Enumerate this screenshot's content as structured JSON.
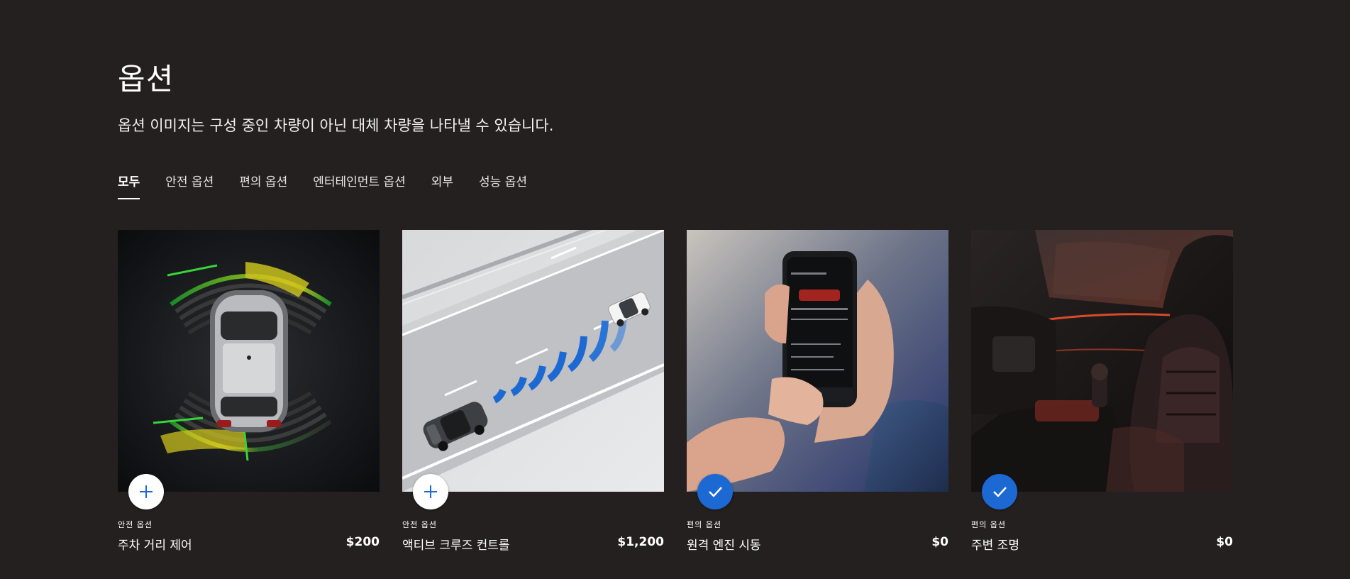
{
  "header": {
    "title": "옵션",
    "subtitle": "옵션 이미지는 구성 중인 차량이 아닌 대체 차량을 나타낼 수 있습니다."
  },
  "tabs": [
    {
      "label": "모두",
      "active": true
    },
    {
      "label": "안전 옵션",
      "active": false
    },
    {
      "label": "편의 옵션",
      "active": false
    },
    {
      "label": "엔터테인먼트 옵션",
      "active": false
    },
    {
      "label": "외부",
      "active": false
    },
    {
      "label": "성능 옵션",
      "active": false
    }
  ],
  "options": [
    {
      "category": "안전 옵션",
      "name": "주차 거리 제어",
      "price": "$200",
      "selected": false,
      "icon": "plus-icon"
    },
    {
      "category": "안전 옵션",
      "name": "액티브 크루즈 컨트롤",
      "price": "$1,200",
      "selected": false,
      "icon": "plus-icon"
    },
    {
      "category": "편의 옵션",
      "name": "원격 엔진 시동",
      "price": "$0",
      "selected": true,
      "icon": "check-icon"
    },
    {
      "category": "편의 옵션",
      "name": "주변 조명",
      "price": "$0",
      "selected": true,
      "icon": "check-icon"
    }
  ],
  "colors": {
    "background": "#252020",
    "accent": "#1c69d4",
    "text": "#ffffff"
  }
}
